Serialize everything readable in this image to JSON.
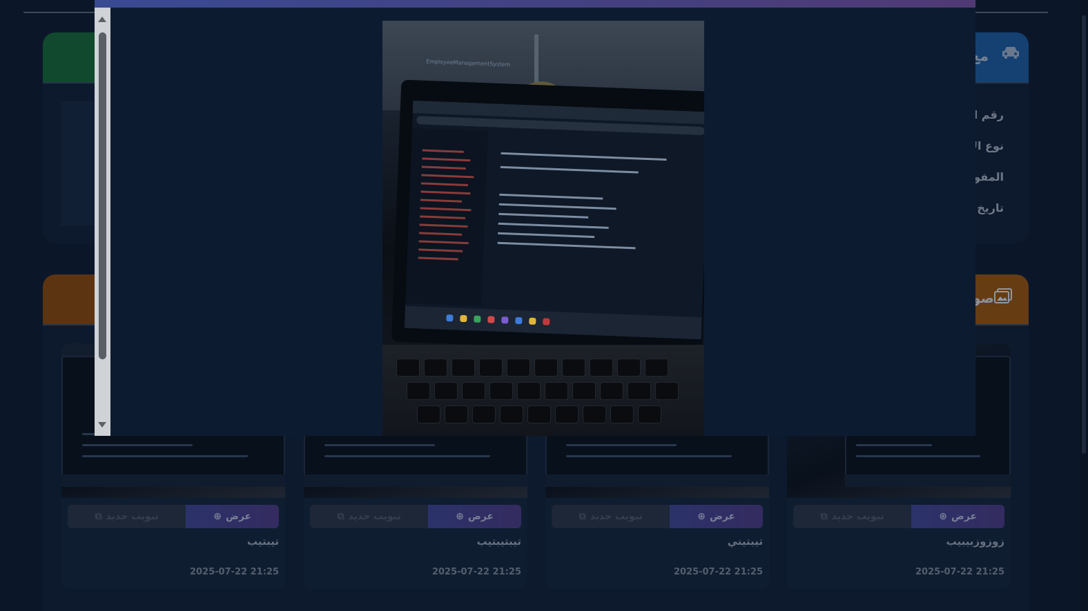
{
  "info_card": {
    "title": "مع",
    "labels": [
      "رقم الا",
      "نوع الا",
      "المفوض",
      "تاريخ ال"
    ]
  },
  "gallery": {
    "title": "صو",
    "photos": [
      {
        "name": "زوزوزبيبيب",
        "date": "2025-07-22 21:25",
        "view_label": "عرض",
        "newtab_label": "تبويب جديد"
      },
      {
        "name": "تيبتيني",
        "date": "2025-07-22 21:25",
        "view_label": "عرض",
        "newtab_label": "تبويب جديد"
      },
      {
        "name": "تيبتيبتيب",
        "date": "2025-07-22 21:25",
        "view_label": "عرض",
        "newtab_label": "تبويب جديد"
      },
      {
        "name": "تيبتيب",
        "date": "2025-07-22 21:25",
        "view_label": "عرض",
        "newtab_label": "تبويب جديد"
      }
    ]
  },
  "preview_modal": {
    "caption": "EmployeeManagementSystem"
  },
  "colors": {
    "background": "#0f1e33",
    "card": "#12233b",
    "green_header": "#166a3a",
    "blue_header": "#1d5ea3",
    "orange_header": "#9a5712",
    "view_button": "#3f4797",
    "modal_bar": "#3a4a93"
  },
  "icons": {
    "info_header": "car-icon",
    "gallery_header": "images-icon",
    "view_button": "search-plus-icon",
    "newtab_button": "external-link-icon"
  }
}
